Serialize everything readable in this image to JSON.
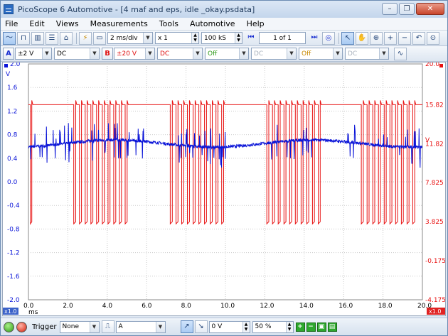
{
  "window": {
    "title": "PicoScope 6 Automotive - [4 maf and eps, idle _okay.psdata]",
    "minimize_glyph": "–",
    "restore_glyph": "❐",
    "close_glyph": "✕"
  },
  "menu": [
    "File",
    "Edit",
    "Views",
    "Measurements",
    "Tools",
    "Automotive",
    "Help"
  ],
  "toolbar1": {
    "timebase": "2 ms/div",
    "zoom": "x 1",
    "samples": "100 kS",
    "page": "1 of 1"
  },
  "toolbar2": {
    "channel_a": {
      "label": "A",
      "range": "±2 V",
      "coupling": "DC"
    },
    "channel_b": {
      "label": "B",
      "range": "±20 V",
      "coupling": "DC"
    },
    "channel_c": {
      "state": "Off",
      "coupling": "DC"
    },
    "channel_d": {
      "state": "Off",
      "coupling": "DC"
    }
  },
  "scope": {
    "left_axis_unit": "V",
    "left_axis_ticks": [
      "2.0",
      "1.6",
      "1.2",
      "0.8",
      "0.4",
      "0.0",
      "-0.4",
      "-0.8",
      "-1.2",
      "-1.6",
      "-2.0"
    ],
    "right_axis_unit": "V",
    "right_axis_ticks": [
      "20.0",
      "15.82",
      "11.82",
      "7.825",
      "3.825",
      "-0.175",
      "-4.175"
    ],
    "x_axis_ticks": [
      "0.0",
      "2.0",
      "4.0",
      "6.0",
      "8.0",
      "10.0",
      "12.0",
      "14.0",
      "16.0",
      "18.0",
      "20.0"
    ],
    "x_axis_unit": "ms",
    "left_zoom_badge": "x1.0",
    "right_zoom_badge": "x1.0",
    "x_zoom_badge": "x1.0",
    "channel_a_color": "#0a14d8",
    "channel_b_color": "#e81010"
  },
  "chart_data": {
    "type": "line",
    "x_unit": "ms",
    "x_range": [
      0,
      20
    ],
    "y_left_range": [
      -2.0,
      2.0
    ],
    "y_right_range": [
      -4.175,
      20.0
    ],
    "series": [
      {
        "channel": "A",
        "baseline_v": 0.65,
        "wave_amplitude_v": 0.06,
        "spike_clusters_ms": [
          [
            0,
            2.2
          ],
          [
            3.2,
            4.8
          ],
          [
            5.0,
            6.0
          ],
          [
            7.6,
            10.0
          ],
          [
            12.2,
            14.4
          ],
          [
            16.0,
            16.6
          ],
          [
            17.2,
            19.9
          ]
        ]
      },
      {
        "channel": "B",
        "high_v": 15.82,
        "low_v": 3.825,
        "pulse_groups_ms": [
          {
            "start": 0.1,
            "end": 0.3,
            "count": 1
          },
          {
            "start": 2.3,
            "end": 5.2,
            "count": 10
          },
          {
            "start": 7.2,
            "end": 10.1,
            "count": 10
          },
          {
            "start": 12.1,
            "end": 15.0,
            "count": 10
          },
          {
            "start": 16.9,
            "end": 19.8,
            "count": 10
          }
        ]
      }
    ]
  },
  "statusbar": {
    "trigger_label": "Trigger",
    "trigger_mode": "None",
    "trigger_source": "A",
    "trigger_level": "0 V",
    "pretrigger": "50 %"
  }
}
